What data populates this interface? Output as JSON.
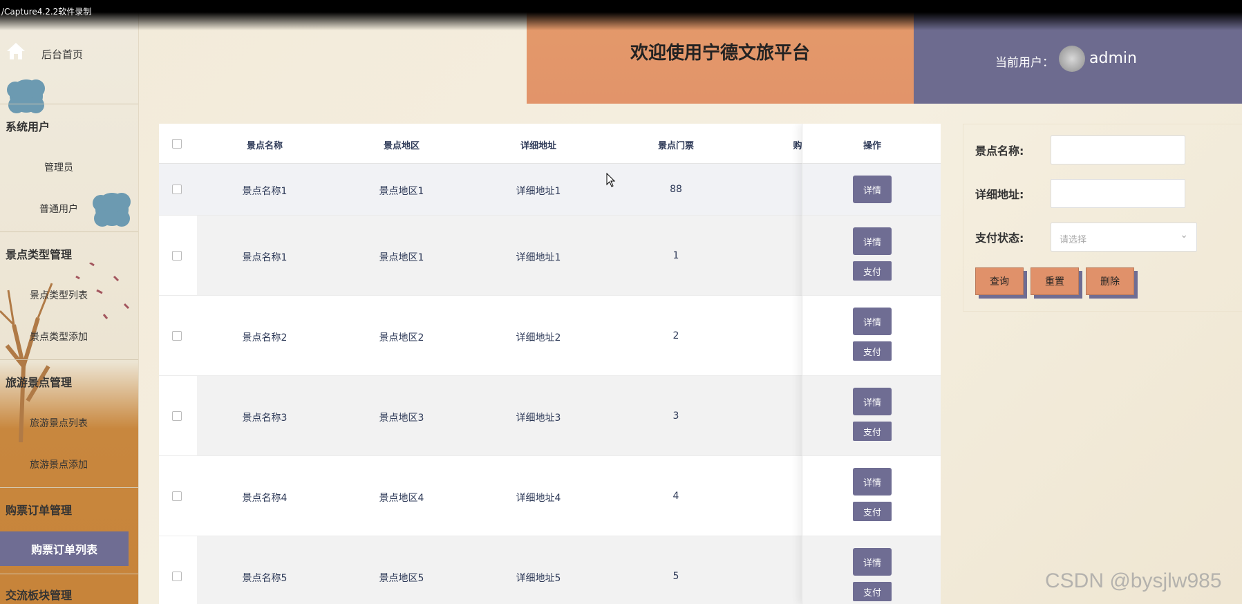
{
  "recorder": {
    "label": "/Capture4.2.2软件录制"
  },
  "sidebar": {
    "home_label": "后台首页",
    "groups": [
      {
        "label": "系统用户",
        "items": [
          "管理员",
          "普通用户"
        ]
      },
      {
        "label": "景点类型管理",
        "items": [
          "景点类型列表",
          "景点类型添加"
        ]
      },
      {
        "label": "旅游景点管理",
        "items": [
          "旅游景点列表",
          "旅游景点添加"
        ]
      },
      {
        "label": "购票订单管理",
        "items": [
          "购票订单列表"
        ]
      },
      {
        "label": "交流板块管理",
        "items": []
      }
    ],
    "active_item": "购票订单列表"
  },
  "header": {
    "title": "欢迎使用宁德文旅平台",
    "user_label": "当前用户：",
    "username": "admin"
  },
  "table": {
    "columns": [
      "景点名称",
      "景点地区",
      "详细地址",
      "景点门票",
      "购",
      "操作"
    ],
    "rows": [
      {
        "name": "景点名称1",
        "region": "景点地区1",
        "address": "详细地址1",
        "ticket": "88",
        "actions": [
          "详情"
        ]
      },
      {
        "name": "景点名称1",
        "region": "景点地区1",
        "address": "详细地址1",
        "ticket": "1",
        "actions": [
          "详情",
          "支付"
        ]
      },
      {
        "name": "景点名称2",
        "region": "景点地区2",
        "address": "详细地址2",
        "ticket": "2",
        "actions": [
          "详情",
          "支付"
        ]
      },
      {
        "name": "景点名称3",
        "region": "景点地区3",
        "address": "详细地址3",
        "ticket": "3",
        "actions": [
          "详情",
          "支付"
        ]
      },
      {
        "name": "景点名称4",
        "region": "景点地区4",
        "address": "详细地址4",
        "ticket": "4",
        "actions": [
          "详情",
          "支付"
        ]
      },
      {
        "name": "景点名称5",
        "region": "景点地区5",
        "address": "详细地址5",
        "ticket": "5",
        "actions": [
          "详情",
          "支付"
        ]
      }
    ]
  },
  "search": {
    "name_label": "景点名称:",
    "address_label": "详细地址:",
    "status_label": "支付状态:",
    "status_placeholder": "请选择",
    "query_button": "查询",
    "reset_button": "重置",
    "delete_button": "删除"
  },
  "watermark": "CSDN @bysjlw985",
  "colors": {
    "accent_purple": "#6f6d93",
    "accent_orange": "#e0916a"
  }
}
